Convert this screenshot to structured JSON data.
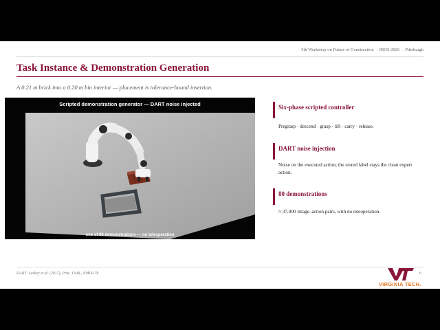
{
  "header": {
    "items": [
      "5th Workshop on Future of Construction",
      "IROS 2026",
      "Pittsburgh"
    ],
    "separator": "·"
  },
  "title": "Task Instance & Demonstration Generation",
  "subtitle": "A 0.21 m brick into a 0.20 m bin interior — placement is tolerance-bound insertion.",
  "figure": {
    "caption": "Scripted demonstration generator — DART noise injected",
    "footer": "one of 80 demonstrations — no teleoperation"
  },
  "cards": [
    {
      "heading": "Six-phase scripted controller",
      "body": "Pregrasp · descend · grasp · lift · carry · release."
    },
    {
      "heading": "DART noise injection",
      "body": "Noise on the executed action; the stored label stays the clean expert action."
    },
    {
      "heading": "80 demonstrations",
      "body": "≈ 37,000 image–action pairs, with no teleoperation."
    }
  ],
  "footer": {
    "citation": "DART: Laskey et al. (2017), Proc. CoRL, PMLR 78.",
    "page": "6",
    "logo_text": "VIRGINIA TECH."
  },
  "colors": {
    "accent": "#8a1538",
    "logo_orange": "#e5751f"
  }
}
